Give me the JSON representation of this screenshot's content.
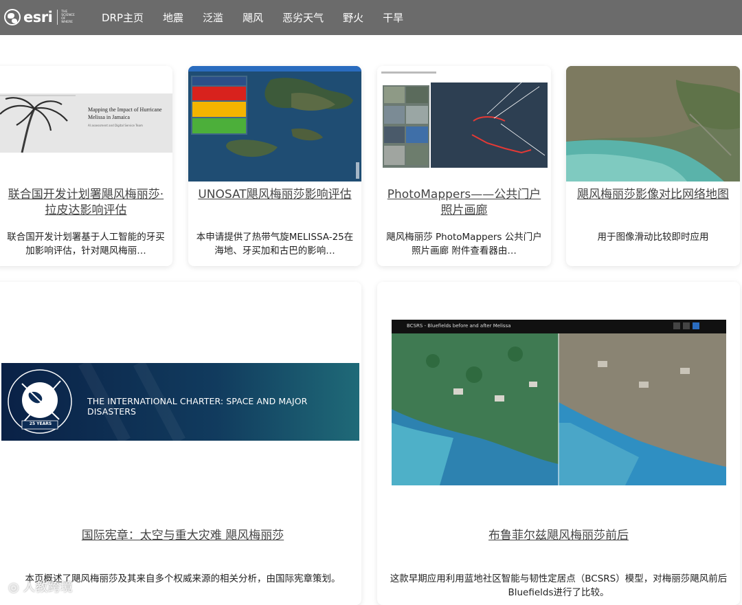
{
  "header": {
    "logo_text": "esri",
    "logo_tagline": "THE SCIENCE OF WHERE",
    "nav": [
      "DRP主页",
      "地震",
      "泛滥",
      "飓风",
      "恶劣天气",
      "野火",
      "干旱"
    ]
  },
  "cards": [
    {
      "title": "联合国开发计划署飓风梅丽莎·拉皮达影响评估",
      "desc": "联合国开发计划署基于人工智能的牙买加影响评估，针对飓风梅丽…",
      "image_caption": "Mapping the Impact of Hurricane Melissa in Jamaica",
      "image_subcaption": "AI assessment and Digital Service Team"
    },
    {
      "title": "UNOSAT飓风梅丽莎影响评估",
      "desc": "本申请提供了热带气旋MELISSA-25在海地、牙买加和古巴的影响…"
    },
    {
      "title": "PhotoMappers——公共门户照片画廊",
      "desc": "飓风梅丽莎 PhotoMappers 公共门户照片画廊 附件查看器由…"
    },
    {
      "title": "飓风梅丽莎影像对比网络地图",
      "desc": "用于图像滑动比较即时应用"
    },
    {
      "title": "国际宪章：太空与重大灾难 飓风梅丽莎",
      "desc": "本页概述了飓风梅丽莎及其来自多个权威来源的相关分析，由国际宪章策划。",
      "image_caption": "THE INTERNATIONAL CHARTER: SPACE AND MAJOR DISASTERS",
      "badge": "25 YEARS"
    },
    {
      "title": "布鲁菲尔兹飓风梅丽莎前后",
      "desc": "这款早期应用利用蓝地社区智能与韧性定居点（BCSRS）模型，对梅丽莎飓风前后Bluefields进行了比较。",
      "image_caption": "BCSRS - Bluefields before and after Melissa"
    }
  ],
  "watermark": "人教跨境",
  "colors": {
    "header_bg": "#6b6b6b",
    "ocean_blue": "#1f4d73",
    "charter_navy": "#0c2c55"
  }
}
